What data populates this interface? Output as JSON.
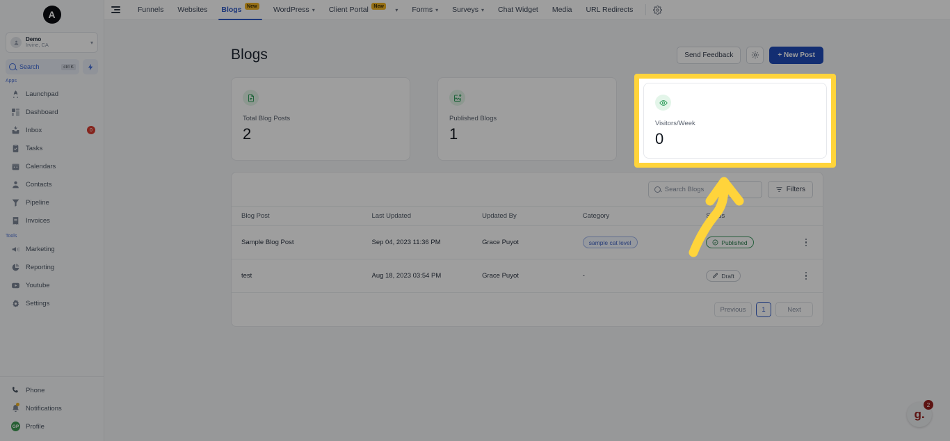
{
  "brand": {
    "logo_letter": "A"
  },
  "sidebar": {
    "location": {
      "name": "Demo",
      "sub": "Irvine, CA",
      "chevron": "chevron-down-icon"
    },
    "search": {
      "label": "Search",
      "shortcut": "ctrl K"
    },
    "section_apps": "Apps",
    "section_tools": "Tools",
    "apps": [
      {
        "label": "Launchpad",
        "icon": "rocket-icon"
      },
      {
        "label": "Dashboard",
        "icon": "grid-icon"
      },
      {
        "label": "Inbox",
        "icon": "inbox-icon",
        "badge": "0"
      },
      {
        "label": "Tasks",
        "icon": "clipboard-check-icon"
      },
      {
        "label": "Calendars",
        "icon": "calendar-icon"
      },
      {
        "label": "Contacts",
        "icon": "user-icon"
      },
      {
        "label": "Pipeline",
        "icon": "funnel-icon"
      },
      {
        "label": "Invoices",
        "icon": "invoice-icon"
      }
    ],
    "tools": [
      {
        "label": "Marketing",
        "icon": "megaphone-icon"
      },
      {
        "label": "Reporting",
        "icon": "pie-chart-icon"
      },
      {
        "label": "Youtube",
        "icon": "youtube-icon"
      },
      {
        "label": "Settings",
        "icon": "gear-icon"
      }
    ],
    "bottom": [
      {
        "label": "Phone",
        "icon": "phone-icon"
      },
      {
        "label": "Notifications",
        "icon": "bell-icon"
      },
      {
        "label": "Profile",
        "icon": "avatar",
        "avatar_initials": "GP"
      }
    ]
  },
  "topnav": {
    "tabs": [
      {
        "label": "Funnels",
        "active": false,
        "caret": false,
        "badge": null
      },
      {
        "label": "Websites",
        "active": false,
        "caret": false,
        "badge": null
      },
      {
        "label": "Blogs",
        "active": true,
        "caret": false,
        "badge": "New"
      },
      {
        "label": "WordPress",
        "active": false,
        "caret": true,
        "badge": null
      },
      {
        "label": "Client Portal",
        "active": false,
        "caret": true,
        "badge": "New"
      },
      {
        "label": "Forms",
        "active": false,
        "caret": true,
        "badge": null
      },
      {
        "label": "Surveys",
        "active": false,
        "caret": true,
        "badge": null
      },
      {
        "label": "Chat Widget",
        "active": false,
        "caret": false,
        "badge": null
      },
      {
        "label": "Media",
        "active": false,
        "caret": false,
        "badge": null
      },
      {
        "label": "URL Redirects",
        "active": false,
        "caret": false,
        "badge": null
      }
    ],
    "settings_icon": "gear-icon",
    "menu_icon": "hamburger-icon"
  },
  "page": {
    "title": "Blogs",
    "send_feedback_label": "Send Feedback",
    "settings_icon": "gear-icon",
    "new_post_label": "+ New Post"
  },
  "stats": [
    {
      "label": "Total Blog Posts",
      "value": "2",
      "icon": "document-icon"
    },
    {
      "label": "Published Blogs",
      "value": "1",
      "icon": "image-upload-icon"
    },
    {
      "label": "Visitors/Week",
      "value": "0",
      "icon": "eye-icon",
      "highlighted": true
    }
  ],
  "toolbar": {
    "search_placeholder": "Search Blogs",
    "search_value": "",
    "search_icon": "search-icon",
    "filters_label": "Filters",
    "filters_icon": "filter-icon"
  },
  "table": {
    "columns": [
      "Blog Post",
      "Last Updated",
      "Updated By",
      "Category",
      "Status",
      ""
    ],
    "rows": [
      {
        "blog_post": "Sample Blog Post",
        "last_updated": "Sep 04, 2023 11:36 PM",
        "updated_by": "Grace Puyot",
        "category": "sample cat level",
        "status": "Published",
        "status_type": "published",
        "menu_icon": "kebab-menu-icon"
      },
      {
        "blog_post": "test",
        "last_updated": "Aug 18, 2023 03:54 PM",
        "updated_by": "Grace Puyot",
        "category": "-",
        "status": "Draft",
        "status_type": "draft",
        "menu_icon": "kebab-menu-icon"
      }
    ]
  },
  "pagination": {
    "previous": "Previous",
    "page": "1",
    "next": "Next"
  },
  "help_widget": {
    "label": "g.",
    "badge": "2"
  },
  "annotation": {
    "highlight_color": "#ffd43b",
    "arrow_color": "#ffd43b",
    "arrow": "curved-up-arrow"
  },
  "colors": {
    "accent_blue": "#2f58c5",
    "primary_button": "#1f4bb8",
    "green": "#2e9e5b",
    "badge_red": "#d63a2f",
    "new_badge": "#f0b323"
  }
}
